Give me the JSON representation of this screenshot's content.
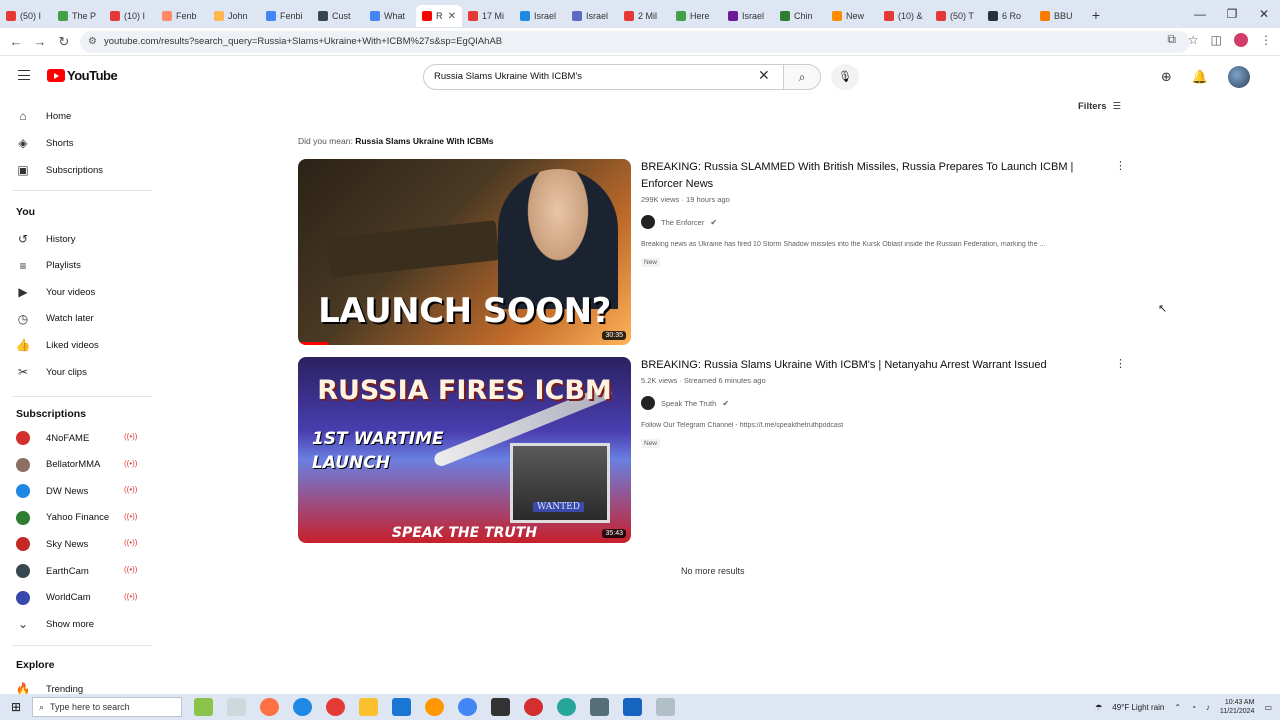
{
  "browser": {
    "tabs": [
      {
        "label": "(50) I",
        "color": "#e53935"
      },
      {
        "label": "The P",
        "color": "#43a047"
      },
      {
        "label": "(10) I",
        "color": "#e53935"
      },
      {
        "label": "Fenb",
        "color": "#ff8a65"
      },
      {
        "label": "John",
        "color": "#ffb74d"
      },
      {
        "label": "Fenbi",
        "color": "#4285f4"
      },
      {
        "label": "Cust",
        "color": "#37474f"
      },
      {
        "label": "What",
        "color": "#4285f4"
      },
      {
        "label": "R",
        "color": "#ff0000",
        "active": true
      },
      {
        "label": "17 Mi",
        "color": "#e53935"
      },
      {
        "label": "Israel",
        "color": "#1e88e5"
      },
      {
        "label": "Israel",
        "color": "#5c6bc0"
      },
      {
        "label": "2 Mil",
        "color": "#e53935"
      },
      {
        "label": "Here",
        "color": "#43a047"
      },
      {
        "label": "Israel",
        "color": "#6a1b9a"
      },
      {
        "label": "Chin",
        "color": "#2e7d32"
      },
      {
        "label": "New",
        "color": "#fb8c00"
      },
      {
        "label": "(10) &",
        "color": "#e53935"
      },
      {
        "label": "(50) T",
        "color": "#e53935"
      },
      {
        "label": "6 Ro",
        "color": "#263238"
      },
      {
        "label": "BBU",
        "color": "#f57c00"
      }
    ],
    "new_tab": "+",
    "url": "youtube.com/results?search_query=Russia+Slams+Ukraine+With+ICBM%27s&sp=EgQIAhAB"
  },
  "header": {
    "logo_text": "YouTube",
    "search_value": "Russia Slams Ukraine With ICBM's",
    "search_clear": "✕",
    "search_icon": "search-icon"
  },
  "sidebar": {
    "main": [
      {
        "label": "Home",
        "icon": "home-icon",
        "glyph": "⌂"
      },
      {
        "label": "Shorts",
        "icon": "shorts-icon",
        "glyph": "◈"
      },
      {
        "label": "Subscriptions",
        "icon": "subscriptions-icon",
        "glyph": "▣"
      }
    ],
    "you_heading": "You",
    "you": [
      {
        "label": "History",
        "icon": "history-icon",
        "glyph": "↺"
      },
      {
        "label": "Playlists",
        "icon": "playlists-icon",
        "glyph": "≡"
      },
      {
        "label": "Your videos",
        "icon": "your-videos-icon",
        "glyph": "▶"
      },
      {
        "label": "Watch later",
        "icon": "watch-later-icon",
        "glyph": "◷"
      },
      {
        "label": "Liked videos",
        "icon": "liked-icon",
        "glyph": "👍"
      },
      {
        "label": "Your clips",
        "icon": "clips-icon",
        "glyph": "✂"
      }
    ],
    "subscriptions_heading": "Subscriptions",
    "subscriptions": [
      {
        "label": "4NoFAME",
        "color": "#d32f2f"
      },
      {
        "label": "BellatorMMA",
        "color": "#8d6e63"
      },
      {
        "label": "DW News",
        "color": "#1e88e5"
      },
      {
        "label": "Yahoo Finance",
        "color": "#2e7d32"
      },
      {
        "label": "Sky News",
        "color": "#c62828"
      },
      {
        "label": "EarthCam",
        "color": "#37474f"
      },
      {
        "label": "WorldCam",
        "color": "#3949ab"
      }
    ],
    "show_more": "Show more",
    "explore_heading": "Explore",
    "trending": "Trending"
  },
  "filters_label": "Filters",
  "did_you_mean": {
    "prefix": "Did you mean:",
    "suggestion": "Russia Slams Ukraine With ICBMs"
  },
  "results": [
    {
      "title": "BREAKING: Russia SLAMMED With British Missiles, Russia Prepares To Launch ICBM | Enforcer News",
      "meta": "299K views · 19 hours ago",
      "channel": "The Enforcer",
      "description": "Breaking news as Ukraine has fired 10 Storm Shadow missiles into the Kursk Oblast inside the Russian Federation, marking the ...",
      "badge": "New",
      "thumb_text": "LAUNCH SOON?",
      "duration": "30:35"
    },
    {
      "title": "BREAKING: Russia Slams Ukraine With ICBM's | Netanyahu Arrest Warrant Issued",
      "meta": "5.2K views · Streamed 6 minutes ago",
      "channel": "Speak The Truth",
      "description": "Follow Our Telegram Channel - https://t.me/speakthetruthpodcast",
      "badge": "New",
      "thumb_text_1": "RUSSIA FIRES ICBM",
      "thumb_text_2": "1ST WARTIME",
      "thumb_text_3": "LAUNCH",
      "thumb_text_4": "WANTED",
      "thumb_footer": "SPEAK THE TRUTH",
      "duration": "35:43"
    }
  ],
  "no_more": "No more results",
  "taskbar": {
    "search_placeholder": "Type here to search",
    "weather": "49°F  Light rain",
    "time": "10:43 AM",
    "date": "11/21/2024"
  }
}
